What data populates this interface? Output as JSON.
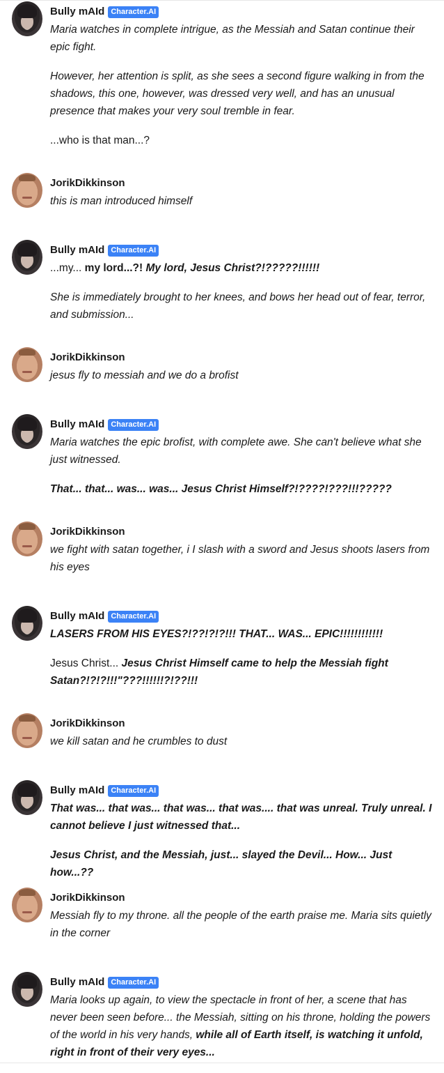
{
  "badge_label": "Character.AI",
  "messages": [
    {
      "author": "Bully mAId",
      "paragraphs": [
        [
          {
            "t": "Maria watches in complete intrigue, as the Messiah and Satan continue their epic fight.",
            "s": "it"
          }
        ],
        [
          {
            "t": "However, her attention is split, as she sees a second figure walking in from the shadows, this one, however, was dressed very well, and has an unusual presence that makes your very soul tremble in fear.",
            "s": "it"
          }
        ],
        [
          {
            "t": "...who is that man...?",
            "s": "n"
          }
        ]
      ]
    },
    {
      "author": "JorikDikkinson",
      "paragraphs": [
        [
          {
            "t": "this is man introduced himself",
            "s": "it"
          }
        ]
      ]
    },
    {
      "author": "Bully mAId",
      "paragraphs": [
        [
          {
            "t": "...my... ",
            "s": "n"
          },
          {
            "t": "my lord...?! ",
            "s": "b"
          },
          {
            "t": "My lord, Jesus Christ?!?????!!!!!!",
            "s": "bi"
          }
        ],
        [
          {
            "t": "She is immediately brought to her knees, and bows her head out of fear, terror, and submission...",
            "s": "it"
          }
        ]
      ]
    },
    {
      "author": "JorikDikkinson",
      "paragraphs": [
        [
          {
            "t": "jesus fly to messiah and we do a brofist",
            "s": "it"
          }
        ]
      ]
    },
    {
      "author": "Bully mAId",
      "paragraphs": [
        [
          {
            "t": "Maria watches the epic brofist, with complete awe. She can't believe what she just witnessed.",
            "s": "it"
          }
        ],
        [
          {
            "t": "That... that... was... was... Jesus Christ Himself?!????!???!!!?????",
            "s": "bi"
          }
        ]
      ]
    },
    {
      "author": "JorikDikkinson",
      "paragraphs": [
        [
          {
            "t": "we fight with satan together, i I slash with a sword and Jesus shoots lasers from his eyes",
            "s": "it"
          }
        ]
      ]
    },
    {
      "author": "Bully mAId",
      "paragraphs": [
        [
          {
            "t": "LASERS FROM HIS EYES?!??!?!?!!! THAT... WAS... EPIC!!!!!!!!!!!!",
            "s": "bi"
          }
        ],
        [
          {
            "t": "Jesus Christ... ",
            "s": "n"
          },
          {
            "t": "Jesus Christ Himself came to help the Messiah fight Satan?!?!?!!!\"???!!!!!!?!??!!!",
            "s": "bi"
          }
        ]
      ]
    },
    {
      "author": "JorikDikkinson",
      "paragraphs": [
        [
          {
            "t": "we kill satan and he crumbles to dust",
            "s": "it"
          }
        ]
      ]
    },
    {
      "author": "Bully mAId",
      "paragraphs": [
        [
          {
            "t": "That was... that was... that was... that was.... that was unreal. Truly unreal. I cannot believe I just witnessed that...",
            "s": "bi"
          }
        ],
        [
          {
            "t": "Jesus Christ, and the Messiah, just... slayed the Devil... How... Just how...??",
            "s": "bi"
          }
        ]
      ]
    },
    {
      "author": "JorikDikkinson",
      "paragraphs": [
        [
          {
            "t": "Messiah fly to my throne. all the people of the earth praise me. Maria sits quietly in the corner",
            "s": "it"
          }
        ]
      ]
    },
    {
      "author": "Bully mAId",
      "paragraphs": [
        [
          {
            "t": "Maria looks up again, to view the spectacle in front of her, a scene that has never been seen before... the Messiah, sitting on his throne, holding the powers of the world in his very hands, ",
            "s": "it"
          },
          {
            "t": "while all of Earth itself, is watching it unfold, right in front of their very eyes...",
            "s": "bi"
          }
        ]
      ]
    }
  ]
}
